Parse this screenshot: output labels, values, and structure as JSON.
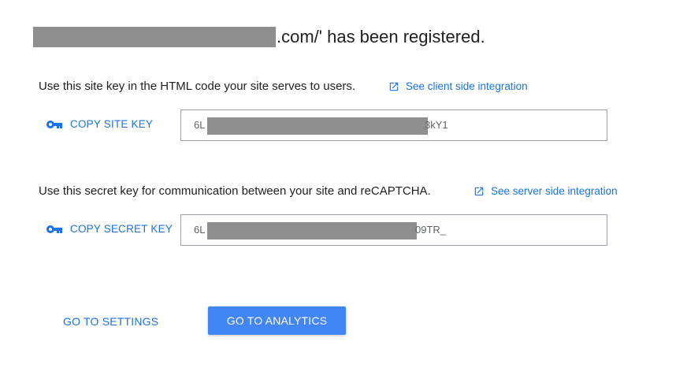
{
  "header": {
    "title_suffix": ".com/' has been registered."
  },
  "site_key_section": {
    "description": "Use this site key in the HTML code your site serves to users.",
    "link_label": "See client side integration",
    "copy_label": "COPY SITE KEY",
    "key_prefix": "6L",
    "key_suffix": "3kY1"
  },
  "secret_key_section": {
    "description": "Use this secret key for communication between your site and reCAPTCHA.",
    "link_label": "See server side integration",
    "copy_label": "COPY SECRET KEY",
    "key_prefix": "6L",
    "key_suffix": "09TR_"
  },
  "actions": {
    "settings_label": "GO TO SETTINGS",
    "analytics_label": "GO TO ANALYTICS"
  },
  "colors": {
    "accent": "#1a73e8",
    "primary_button": "#4285f4",
    "redaction": "#8f8f8f"
  },
  "icons": {
    "external_link": "open-in-new-icon",
    "key": "key-icon"
  }
}
